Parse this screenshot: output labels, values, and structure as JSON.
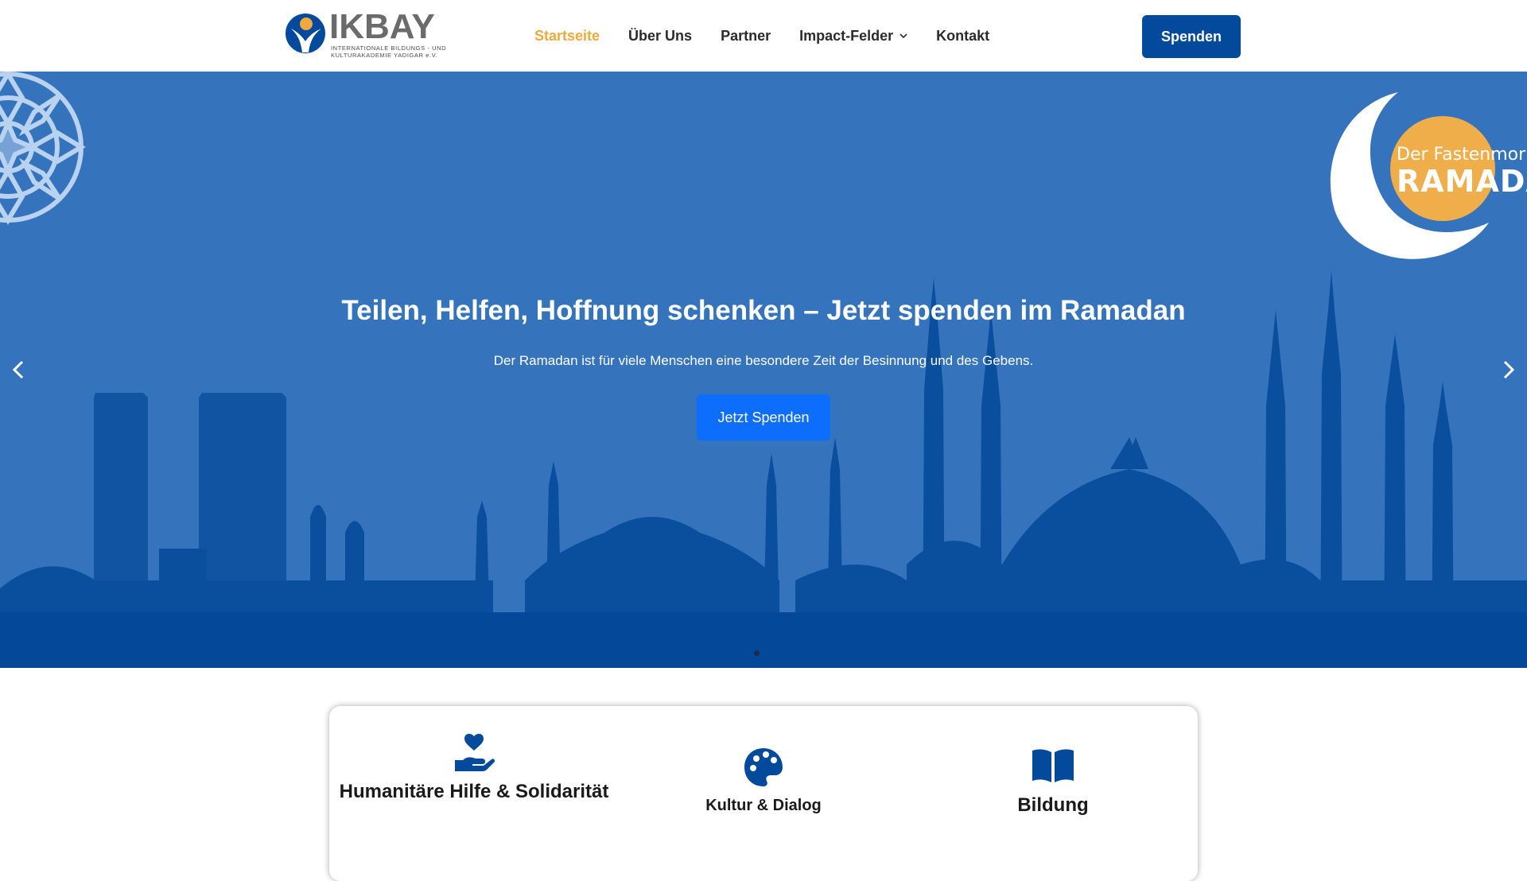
{
  "brand": {
    "name": "IKBAY",
    "tagline_line1": "INTERNATIONALE BILDUNGS - UND",
    "tagline_line2": "KULTURAKADEMIE YADIGAR e.V."
  },
  "nav": {
    "items": [
      {
        "label": "Startseite",
        "active": true
      },
      {
        "label": "Über Uns"
      },
      {
        "label": "Partner"
      },
      {
        "label": "Impact-Felder",
        "has_dropdown": true,
        "icon": "chevron-down-icon"
      },
      {
        "label": "Kontakt"
      }
    ],
    "donate_label": "Spenden"
  },
  "hero": {
    "title": "Teilen, Helfen, Hoffnung schenken – Jetzt spenden im Ramadan",
    "subtitle": "Der Ramadan ist für viele Menschen eine besondere Zeit der Besinnung und des Gebens.",
    "button_label": "Jetzt Spenden",
    "badge_line1": "Der Fastenmor",
    "badge_line2": "RAMADA",
    "prev_icon": "chevron-left-icon",
    "next_icon": "chevron-right-icon",
    "slide_count": 1
  },
  "features": [
    {
      "title": "Humanitäre Hilfe & Solidarität",
      "icon": "hand-heart-icon"
    },
    {
      "title": "Kultur & Dialog",
      "icon": "palette-icon"
    },
    {
      "title": "Bildung",
      "icon": "book-open-icon"
    }
  ],
  "colors": {
    "brand_blue": "#034a9c",
    "accent_orange": "#f0a93b",
    "hero_bg": "#3573bd",
    "skyline": "#0a4f9e",
    "button_blue": "#0d6efd"
  }
}
